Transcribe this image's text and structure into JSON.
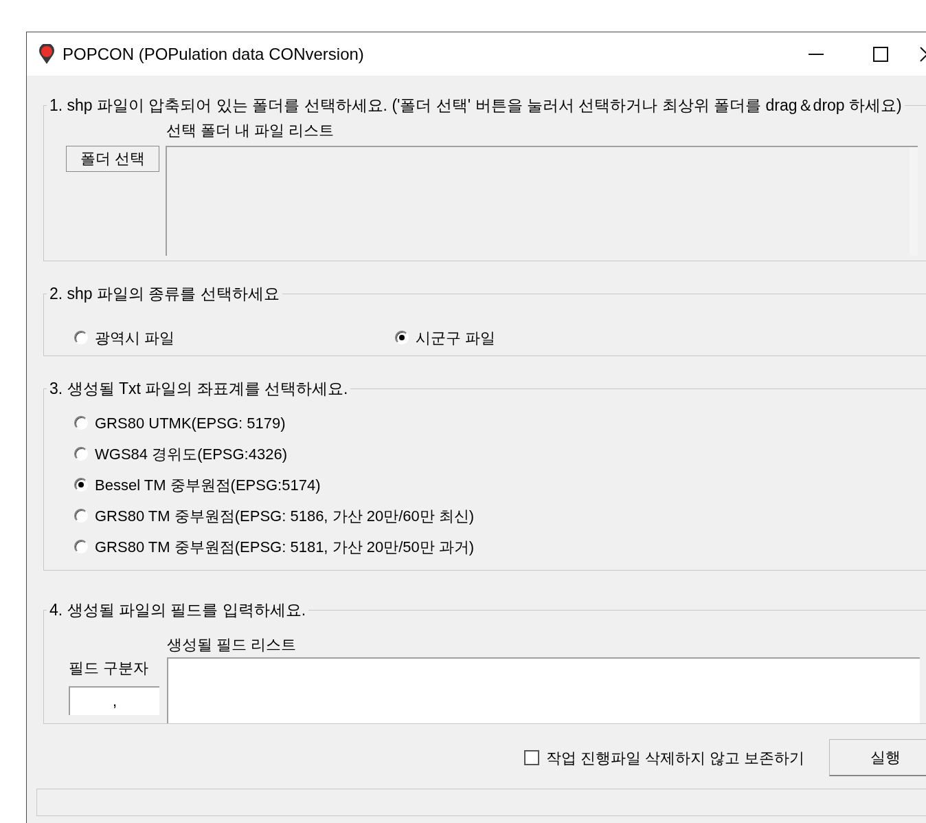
{
  "window": {
    "title": "POPCON (POPulation data CONversion)"
  },
  "folder_group": {
    "legend": "1. shp 파일이 압축되어 있는 폴더를 선택하세요. ('폴더 선택' 버튼을 눌러서 선택하거나 최상위 폴더를 drag＆drop 하세요)",
    "list_label": "선택 폴더 내 파일 리스트",
    "button": "폴더 선택"
  },
  "type_group": {
    "legend": "2. shp 파일의 종류를 선택하세요",
    "options": [
      {
        "label": "광역시 파일",
        "selected": false
      },
      {
        "label": "시군구 파일",
        "selected": true
      }
    ]
  },
  "crs_group": {
    "legend": "3. 생성될 Txt 파일의 좌표계를 선택하세요.",
    "options": [
      {
        "label": "GRS80 UTMK(EPSG: 5179)",
        "selected": false
      },
      {
        "label": "WGS84 경위도(EPSG:4326)",
        "selected": false
      },
      {
        "label": "Bessel TM 중부원점(EPSG:5174)",
        "selected": true
      },
      {
        "label": "GRS80 TM 중부원점(EPSG: 5186, 가산 20만/60만 최신)",
        "selected": false
      },
      {
        "label": "GRS80 TM 중부원점(EPSG: 5181, 가산 20만/50만 과거)",
        "selected": false
      }
    ]
  },
  "field_group": {
    "legend": "4. 생성될 파일의 필드를 입력하세요.",
    "list_label": "생성될 필드 리스트",
    "separator_label": "필드 구분자",
    "separator_value": ","
  },
  "footer": {
    "keep_files": {
      "label": "작업 진행파일 삭제하지 않고 보존하기",
      "checked": false
    },
    "run_button": "실행"
  }
}
